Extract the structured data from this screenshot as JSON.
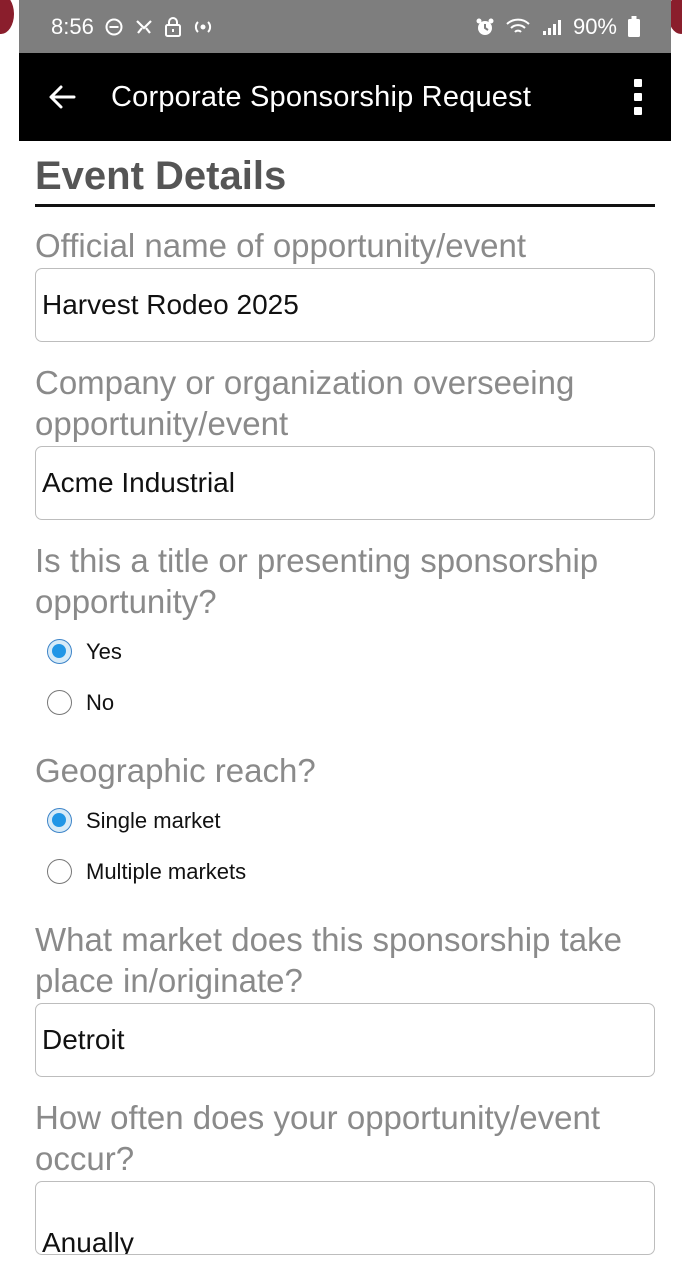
{
  "status_bar": {
    "time": "8:56",
    "battery": "90%"
  },
  "app_bar": {
    "title": "Corporate Sponsorship Request"
  },
  "form": {
    "section_title": "Event Details",
    "official_name": {
      "label": "Official name of opportunity/event",
      "value": "Harvest Rodeo 2025"
    },
    "company": {
      "label": "Company or organization overseeing opportunity/event",
      "value": "Acme Industrial"
    },
    "title_sponsorship": {
      "label": "Is this a title or presenting sponsorship opportunity?",
      "options": [
        "Yes",
        "No"
      ],
      "selected": "Yes"
    },
    "geographic_reach": {
      "label": "Geographic reach?",
      "options": [
        "Single market",
        "Multiple markets"
      ],
      "selected": "Single market"
    },
    "market": {
      "label": "What market does this sponsorship take place in/originate?",
      "value": "Detroit"
    },
    "frequency": {
      "label": "How often does your opportunity/event occur?",
      "value": "Anually"
    }
  },
  "colors": {
    "app_bar": "#000000",
    "status_bar": "#7e7e7e",
    "radio_selected": "#2196e6",
    "label_text": "#8a8a8a"
  }
}
